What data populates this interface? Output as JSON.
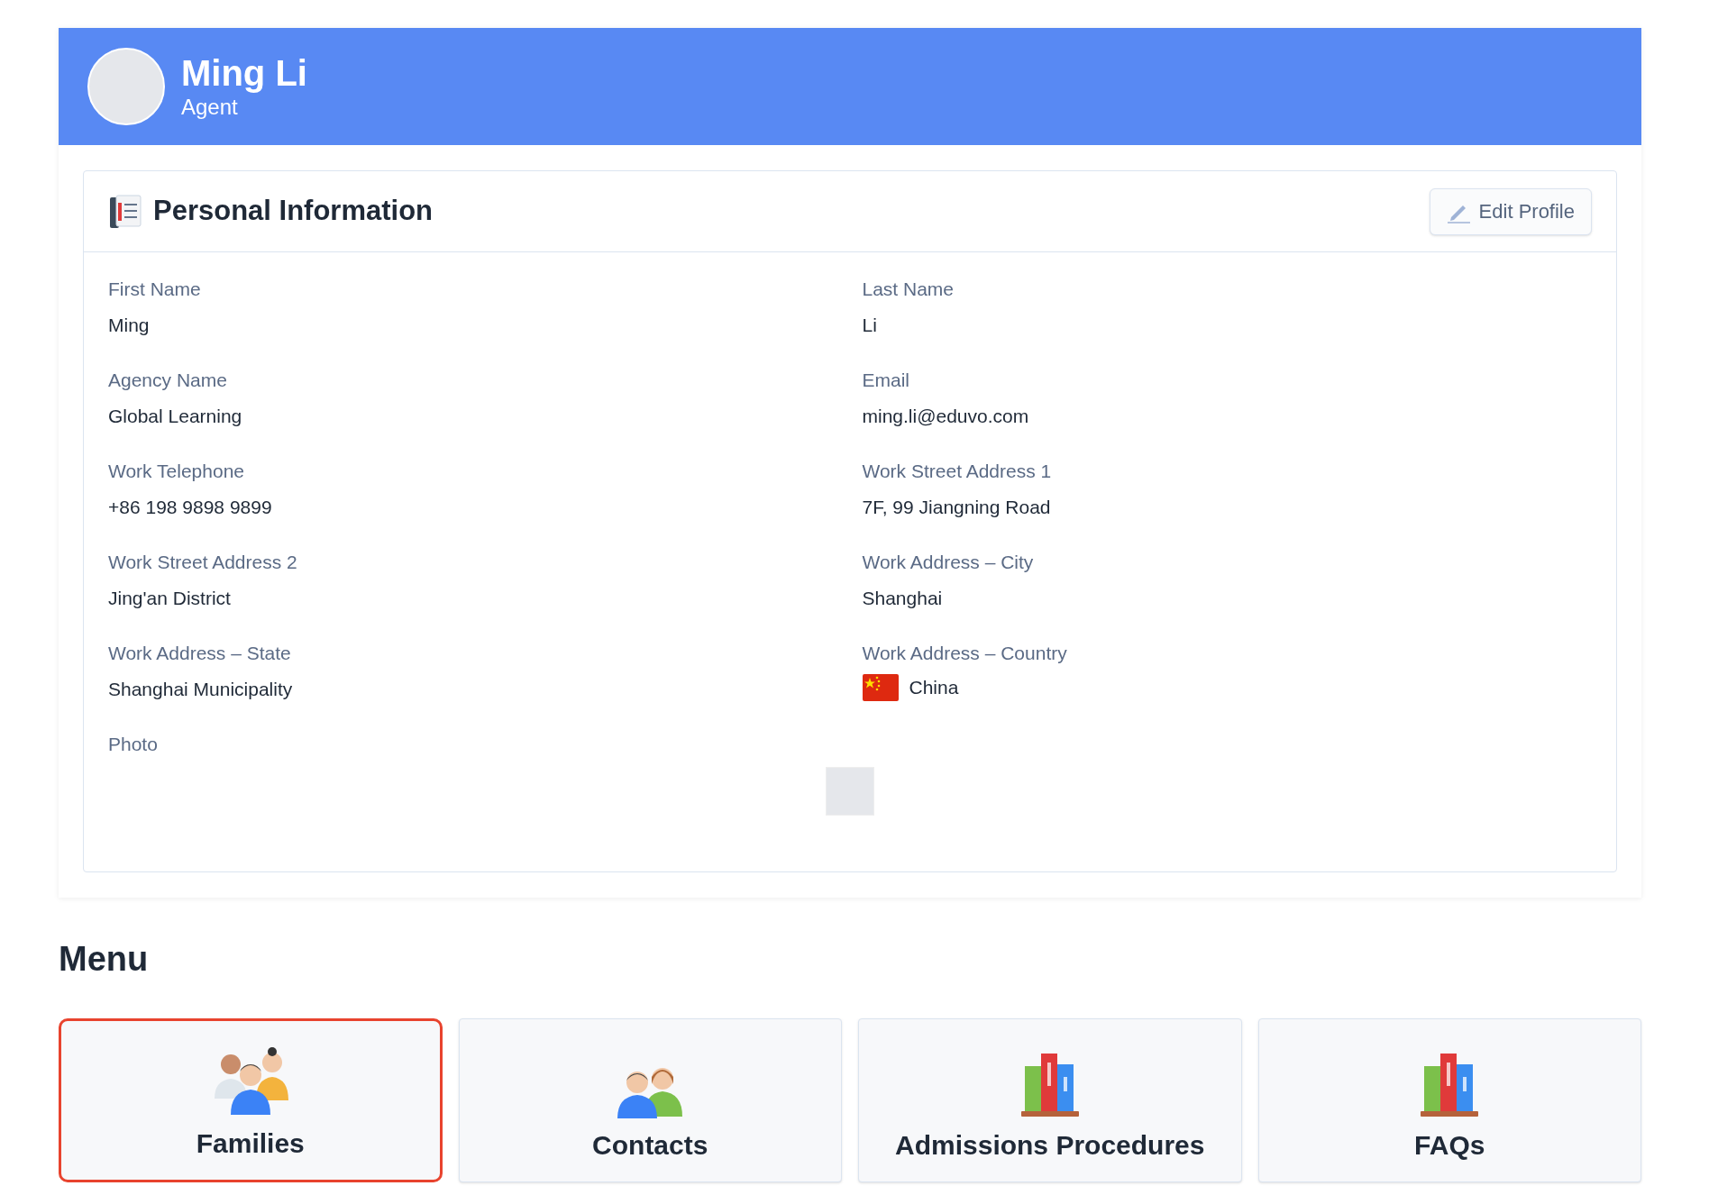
{
  "profile": {
    "name": "Ming Li",
    "role": "Agent"
  },
  "section": {
    "title": "Personal Information",
    "edit_button": "Edit Profile"
  },
  "fields": [
    {
      "label": "First Name",
      "value": "Ming",
      "kind": "text"
    },
    {
      "label": "Last Name",
      "value": "Li",
      "kind": "text"
    },
    {
      "label": "Agency Name",
      "value": "Global Learning",
      "kind": "text"
    },
    {
      "label": "Email",
      "value": "ming.li@eduvo.com",
      "kind": "text"
    },
    {
      "label": "Work Telephone",
      "value": "+86 198 9898 9899",
      "kind": "text"
    },
    {
      "label": "Work Street Address 1",
      "value": "7F, 99 Jiangning Road",
      "kind": "text"
    },
    {
      "label": "Work Street Address 2",
      "value": "Jing'an District",
      "kind": "text"
    },
    {
      "label": "Work Address – City",
      "value": "Shanghai",
      "kind": "text"
    },
    {
      "label": "Work Address – State",
      "value": "Shanghai Municipality",
      "kind": "text"
    },
    {
      "label": "Work Address – Country",
      "value": "China",
      "kind": "country"
    }
  ],
  "photo": {
    "label": "Photo"
  },
  "menu": {
    "title": "Menu",
    "items": [
      {
        "label": "Families",
        "kind": "family",
        "selected": true
      },
      {
        "label": "Contacts",
        "kind": "contacts",
        "selected": false
      },
      {
        "label": "Admissions Procedures",
        "kind": "books",
        "selected": false
      },
      {
        "label": "FAQs",
        "kind": "books",
        "selected": false
      }
    ]
  }
}
